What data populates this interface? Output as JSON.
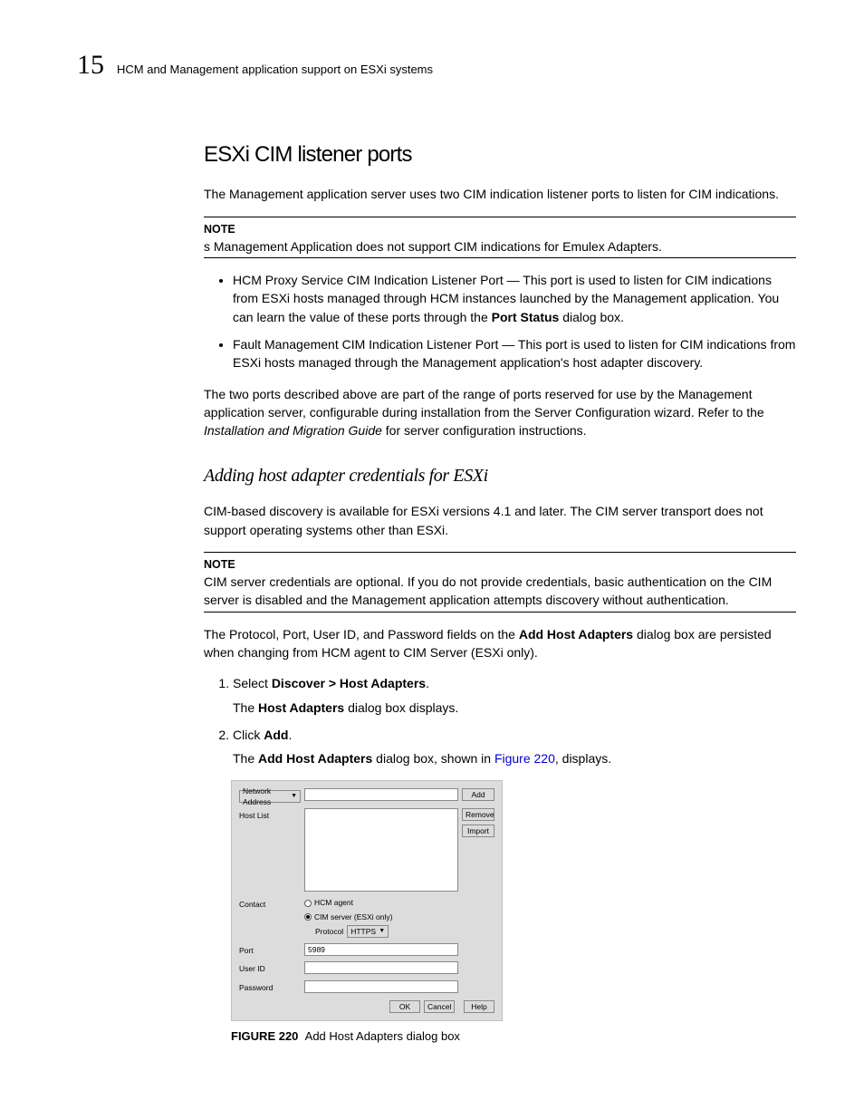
{
  "header": {
    "page_number": "15",
    "running_head": "HCM and Management application support on ESXi systems"
  },
  "section": {
    "title": "ESXi CIM listener ports",
    "intro": "The Management application server uses two CIM indication listener ports to listen for CIM indications.",
    "note1": {
      "label": "NOTE",
      "body": "s Management Application does not support CIM indications for Emulex Adapters."
    },
    "bullets": [
      {
        "prefix": "HCM Proxy Service CIM Indication Listener Port — This port is used to listen for CIM indications from ESXi hosts managed through HCM instances launched by the Management application. You can learn the value of these ports through the ",
        "bold": "Port Status",
        "suffix": " dialog box."
      },
      {
        "prefix": "Fault Management CIM Indication Listener Port — This port is used to listen for CIM indications from ESXi hosts managed through the Management application's host adapter discovery.",
        "bold": "",
        "suffix": ""
      }
    ],
    "para2_a": "The two ports described above are part of the range of ports reserved for use by the Management application server, configurable during installation from the Server Configuration wizard. Refer to the ",
    "para2_it": "Installation and Migration Guide",
    "para2_b": " for server configuration instructions."
  },
  "subsection": {
    "title": "Adding host adapter credentials for ESXi",
    "intro": "CIM-based discovery is available for ESXi versions 4.1 and later. The CIM server transport does not support operating systems other than ESXi.",
    "note2": {
      "label": "NOTE",
      "body": "CIM server credentials are optional. If you do not provide credentials, basic authentication on the CIM server is disabled and the Management application attempts discovery without authentication."
    },
    "para3_a": "The Protocol, Port, User ID, and Password fields on the ",
    "para3_bold": "Add Host Adapters",
    "para3_b": " dialog box are persisted when changing from HCM agent to CIM Server (ESXi only).",
    "steps": {
      "s1_pre": "Select ",
      "s1_bold": "Discover > Host Adapters",
      "s1_suf": ".",
      "s1_sub_a": "The ",
      "s1_sub_bold": "Host Adapters",
      "s1_sub_b": " dialog box displays.",
      "s2_pre": "Click ",
      "s2_bold": "Add",
      "s2_suf": ".",
      "s2_sub_a": "The ",
      "s2_sub_bold": "Add Host Adapters",
      "s2_sub_b": " dialog box, shown in ",
      "s2_sub_link": "Figure 220",
      "s2_sub_c": ", displays."
    }
  },
  "dialog": {
    "network_address_label": "Network Address",
    "host_list_label": "Host List",
    "contact_label": "Contact",
    "radio_hcm": "HCM agent",
    "radio_cim": "CIM server (ESXi only)",
    "protocol_label": "Protocol",
    "protocol_value": "HTTPS",
    "port_label": "Port",
    "port_value": "5989",
    "userid_label": "User ID",
    "password_label": "Password",
    "btn_add": "Add",
    "btn_remove": "Remove",
    "btn_import": "Import",
    "btn_ok": "OK",
    "btn_cancel": "Cancel",
    "btn_help": "Help"
  },
  "figure": {
    "label": "FIGURE 220",
    "caption": "Add Host Adapters dialog box"
  }
}
